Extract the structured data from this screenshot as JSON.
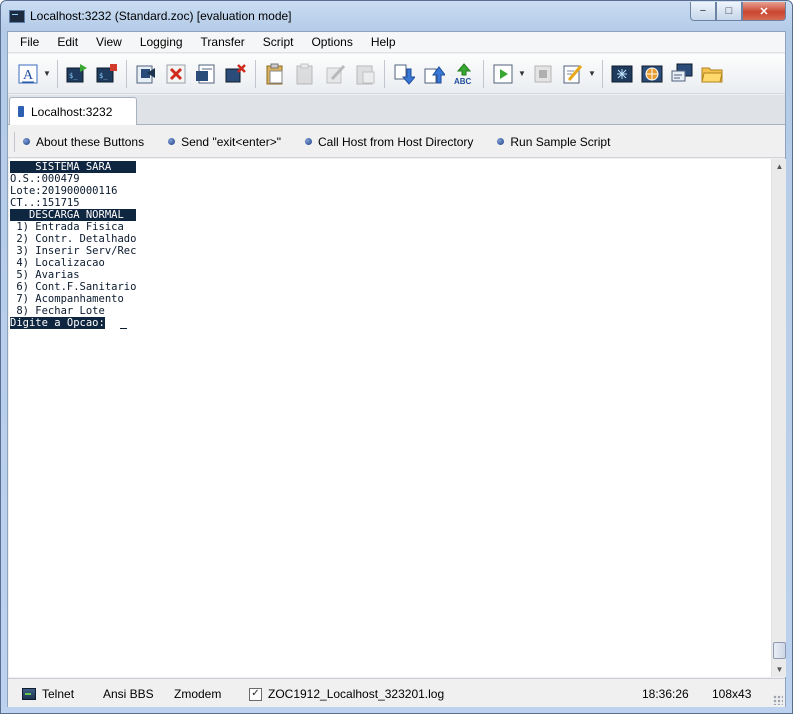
{
  "window": {
    "title": "Localhost:3232 (Standard.zoc) [evaluation mode]",
    "controls": {
      "minimize": "−",
      "maximize": "□",
      "close": "✕"
    }
  },
  "menu": [
    "File",
    "Edit",
    "View",
    "Logging",
    "Transfer",
    "Script",
    "Options",
    "Help"
  ],
  "toolbar": {
    "icons": [
      "font-icon",
      "connect-icon",
      "disconnect-icon",
      "host-directory-icon",
      "cancel-icon",
      "session-icon",
      "close-session-icon",
      "paste-icon",
      "copy-icon",
      "edit-icon",
      "clipboard-icon",
      "download-icon",
      "upload-icon",
      "spellcheck-icon",
      "run-script-icon",
      "stop-icon",
      "edit-script-icon",
      "fullscreen-icon",
      "globe-icon",
      "monitor-icon",
      "folder-icon"
    ]
  },
  "tabs": [
    {
      "label": "Localhost:3232"
    }
  ],
  "buttonbar": [
    {
      "label": "About these Buttons"
    },
    {
      "label": "Send \"exit<enter>\""
    },
    {
      "label": "Call Host from Host Directory"
    },
    {
      "label": "Run Sample Script"
    }
  ],
  "terminal": {
    "lines": [
      {
        "text": "    SISTEMA SARA    ",
        "inverse": true
      },
      {
        "text": "O.S.:000479",
        "inverse": false
      },
      {
        "text": "Lote:201900000116",
        "inverse": false
      },
      {
        "text": "CT..:151715",
        "inverse": false
      },
      {
        "text": "   DESCARGA NORMAL  ",
        "inverse": true
      },
      {
        "text": " 1) Entrada Fisica",
        "inverse": false
      },
      {
        "text": " 2) Contr. Detalhado",
        "inverse": false
      },
      {
        "text": " 3) Inserir Serv/Rec",
        "inverse": false
      },
      {
        "text": " 4) Localizacao",
        "inverse": false
      },
      {
        "text": " 5) Avarias",
        "inverse": false
      },
      {
        "text": " 6) Cont.F.Sanitario",
        "inverse": false
      },
      {
        "text": " 7) Acompanhamento",
        "inverse": false
      },
      {
        "text": " 8) Fechar Lote",
        "inverse": false
      },
      {
        "text": "Digite a Opcao:",
        "inverse": true
      }
    ]
  },
  "statusbar": {
    "protocol": "Telnet",
    "emulation": "Ansi BBS",
    "transfer": "Zmodem",
    "log_checked": true,
    "log_file": "ZOC1912_Localhost_323201.log",
    "time": "18:36:26",
    "size": "108x43"
  },
  "colors": {
    "terminal_bg": "#ffffff",
    "terminal_inverse_bg": "#0f2640",
    "terminal_fg": "#0a1a2e",
    "accent": "#2d5fb3"
  }
}
